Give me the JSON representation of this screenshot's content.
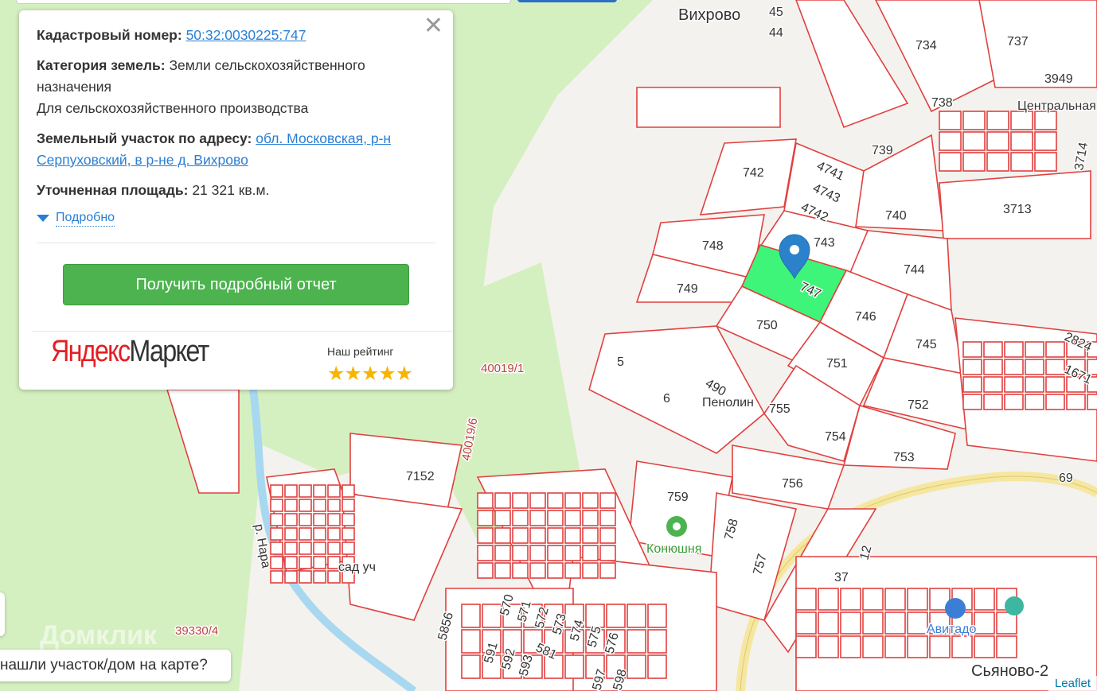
{
  "popup": {
    "cadastral_label": "Кадастровый номер:",
    "cadastral_value": "50:32:0030225:747",
    "category_label": "Категория земель:",
    "category_value": "Земли сельскохозяйственного назначения",
    "usage": "Для сельскохозяйственного производства",
    "address_label": "Земельный участок по адресу:",
    "address_value": "обл. Московская, р-н Серпуховский, в р-не д. Вихрово",
    "area_label": "Уточненная площадь:",
    "area_value": "21 321 кв.м.",
    "more_label": "Подробно",
    "report_button": "Получить подробный отчет",
    "ad_brand_1": "Яндекс",
    "ad_brand_2": "Маркет",
    "rating_label": "Наш рейтинг",
    "rating_stars": "★★★★★",
    "rating_value": 5
  },
  "map": {
    "labels": [
      "Вихрово",
      "45",
      "44",
      "734",
      "737",
      "3949",
      "738",
      "Центральная",
      "3714",
      "739",
      "742",
      "4741",
      "4743",
      "4742",
      "740",
      "3713",
      "748",
      "743",
      "744",
      "749",
      "747",
      "746",
      "750",
      "745",
      "2824",
      "751",
      "1671",
      "40019/1",
      "5",
      "490",
      "Пенолин",
      "6",
      "755",
      "752",
      "754",
      "753",
      "69",
      "756",
      "7152",
      "40019/6",
      "759",
      "Конюшня",
      "758",
      "757",
      "р. Нара",
      "сад уч",
      "39330/4",
      "5856",
      "12",
      "37",
      "Авитадо",
      "Сьяново-2",
      "570",
      "571",
      "572",
      "573",
      "574",
      "575",
      "576",
      "591",
      "592",
      "593",
      "581",
      "597",
      "598"
    ],
    "selected_parcel": "747",
    "parcel_stroke": "#e0403f",
    "selected_fill": "#3ef57a",
    "green_area": "#d5f0c0"
  },
  "question_text": "нашли участок/дом на карте?",
  "watermark": "Домклик",
  "attribution": "Leaflet"
}
